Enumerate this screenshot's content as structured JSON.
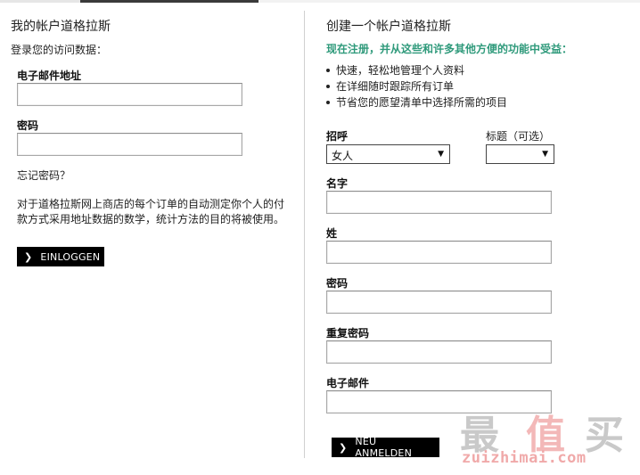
{
  "login": {
    "title": "我的帐户道格拉斯",
    "subtitle": "登录您的访问数据：",
    "email_label": "电子邮件地址",
    "email_value": "",
    "password_label": "密码",
    "password_value": "",
    "forgot_link": "忘记密码？",
    "notice": "对于道格拉斯网上商店的每个订单的自动测定你个人的付款方式采用地址数据的数学，统计方法的目的将被使用。",
    "login_button": "EINLOGGEN"
  },
  "register": {
    "title": "创建一个帐户道格拉斯",
    "promo": "现在注册，并从这些和许多其他方便的功能中受益：",
    "benefits": [
      "快速，轻松地管理个人资料",
      "在详细随时跟踪所有订单",
      "节省您的愿望清单中选择所需的项目"
    ],
    "salutation_label": "招呼",
    "salutation_value": "女人",
    "title_label": "标题（可选）",
    "title_value": "",
    "firstname_label": "名字",
    "lastname_label": "姓",
    "password_label": "密码",
    "repeat_password_label": "重复密码",
    "email_label": "电子邮件",
    "register_button": "NEU ANMELDEN"
  },
  "watermark": {
    "chars": [
      "最",
      "值",
      "买"
    ],
    "url": "zuizhimai.com"
  },
  "icons": {
    "button_chevron": "chevron-right-icon",
    "select_arrow": "caret-down-icon"
  },
  "colors": {
    "accent_green": "#2f9a7b",
    "button_bg": "#000000",
    "watermark_red": "#f0a9a9",
    "watermark_gray": "#c9c9c9"
  }
}
